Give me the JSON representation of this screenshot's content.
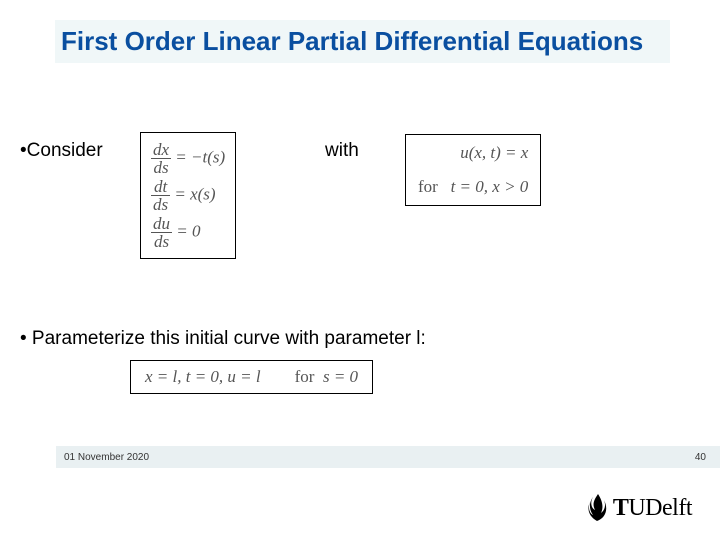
{
  "title": "First Order Linear Partial Differential Equations",
  "bullets": {
    "consider": "•Consider",
    "with": "with",
    "param": "• Parameterize this initial curve with parameter l:"
  },
  "equations": {
    "sys1_num": "dx",
    "sys1_den": "ds",
    "sys1_rhs": "= −t(s)",
    "sys2_num": "dt",
    "sys2_den": "ds",
    "sys2_rhs": "= x(s)",
    "sys3_num": "du",
    "sys3_den": "ds",
    "sys3_rhs": "= 0",
    "ic_line1": "u(x, t) = x",
    "ic_line2_for": "for",
    "ic_line2_rest": "t = 0, x > 0",
    "param_lhs": "x = l, t = 0, u = l",
    "param_for": "for",
    "param_rhs": "s = 0"
  },
  "footer": {
    "date": "01 November 2020",
    "page": "40"
  },
  "logo": {
    "tu": "T",
    "delft": "UDelft"
  }
}
